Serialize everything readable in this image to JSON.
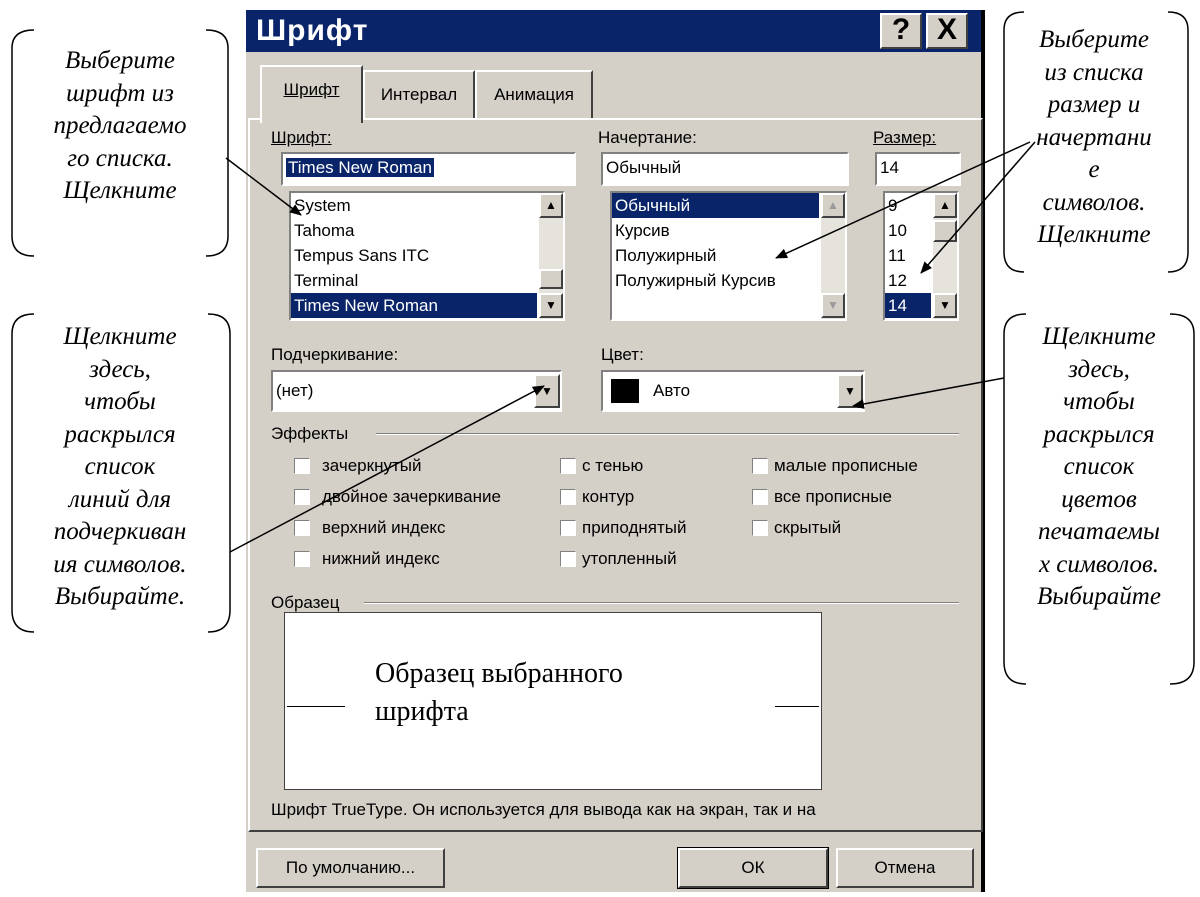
{
  "dialog": {
    "title": "Шрифт",
    "help_button": "?",
    "close_button": "X",
    "tabs": [
      {
        "label": "Шрифт",
        "active": true
      },
      {
        "label": "Интервал",
        "active": false
      },
      {
        "label": "Анимация",
        "active": false
      }
    ],
    "font": {
      "label": "Шрифт:",
      "value": "Times New Roman",
      "list": [
        "System",
        "Tahoma",
        "Tempus Sans ITC",
        "Terminal",
        "Times New Roman"
      ],
      "selected": "Times New Roman"
    },
    "style": {
      "label": "Начертание:",
      "value": "Обычный",
      "list": [
        "Обычный",
        "Курсив",
        "Полужирный",
        "Полужирный Курсив"
      ],
      "selected": "Обычный"
    },
    "size": {
      "label": "Размер:",
      "value": "14",
      "list": [
        "9",
        "10",
        "11",
        "12",
        "14"
      ],
      "selected": "14"
    },
    "underline": {
      "label": "Подчеркивание:",
      "value": "(нет)"
    },
    "color": {
      "label": "Цвет:",
      "value": "Авто",
      "swatch": "#000000"
    },
    "effects": {
      "label": "Эффекты",
      "col1": [
        "зачеркнутый",
        "двойное зачеркивание",
        "верхний индекс",
        "нижний индекс"
      ],
      "col2": [
        "с тенью",
        "контур",
        "приподнятый",
        "утопленный"
      ],
      "col3": [
        "малые прописные",
        "все прописные",
        "скрытый"
      ]
    },
    "sample": {
      "label": "Образец",
      "text_line1": "Образец выбранного",
      "text_line2": "шрифта"
    },
    "description": "Шрифт TrueType. Он используется для вывода как на экран, так и на",
    "buttons": {
      "default": "По умолчанию...",
      "ok": "ОК",
      "cancel": "Отмена"
    }
  },
  "callouts": {
    "top_left": [
      "Выберите",
      "шрифт из",
      "предлагаемо",
      "го списка.",
      "Щелкните"
    ],
    "top_right": [
      "Выберите",
      "из списка",
      "размер и",
      "начертани",
      "е",
      "символов.",
      "Щелкните"
    ],
    "mid_left": [
      "Щелкните",
      "здесь,",
      "чтобы",
      "раскрылся",
      "список",
      "линий для",
      "подчеркиван",
      "ия символов.",
      "Выбирайте."
    ],
    "mid_right": [
      "Щелкните",
      "здесь,",
      "чтобы",
      "раскрылся",
      "список",
      "цветов",
      "печатаемы",
      "х символов.",
      "Выбирайте"
    ]
  },
  "colors": {
    "titlebar": "#0a246a",
    "dialog_face": "#d4d0c8",
    "selection": "#0a246a"
  },
  "icons": [
    "help-icon",
    "close-icon",
    "scroll-up-icon",
    "scroll-down-icon",
    "dropdown-arrow-icon",
    "checkbox-icon",
    "color-swatch-icon"
  ]
}
